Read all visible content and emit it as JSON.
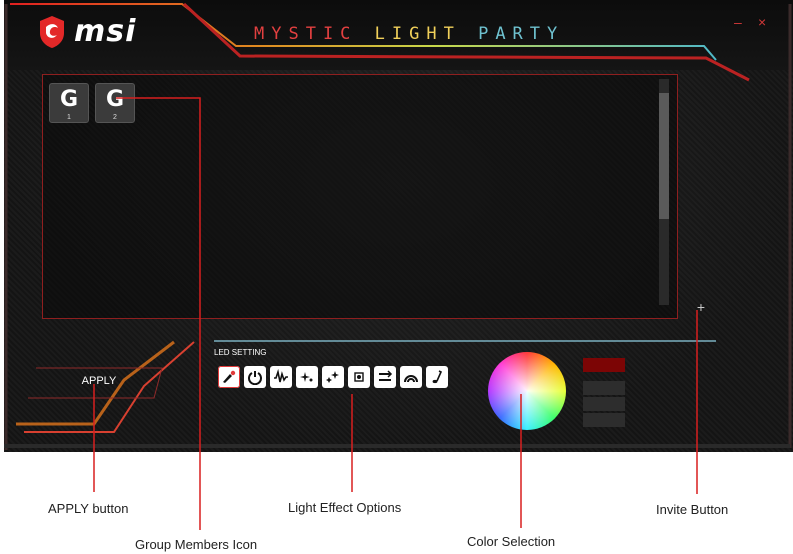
{
  "app": {
    "brand": "msi",
    "title_part1": "MYSTIC ",
    "title_part2": "LIGHT ",
    "title_part3": "PARTY",
    "minimize_label": "–",
    "close_label": "×"
  },
  "members": [
    {
      "glyph": "G",
      "number": "1"
    },
    {
      "glyph": "G",
      "number": "2"
    }
  ],
  "invite_label": "+",
  "apply_label": "APPLY",
  "led_setting_label": "LED SETTING",
  "effects": [
    {
      "name": "color-palette-icon"
    },
    {
      "name": "power-icon"
    },
    {
      "name": "wave-icon"
    },
    {
      "name": "sparkle-icon"
    },
    {
      "name": "stars-icon"
    },
    {
      "name": "burst-icon"
    },
    {
      "name": "arrows-icon"
    },
    {
      "name": "rainbow-icon"
    },
    {
      "name": "music-icon"
    }
  ],
  "color_swatches": [
    "#7c0505",
    "#2d2d2d",
    "#2d2d2d",
    "#2d2d2d"
  ],
  "annotations": {
    "apply": "APPLY button",
    "members": "Group Members Icon",
    "effects": "Light Effect Options",
    "color": "Color Selection",
    "invite": "Invite Button"
  }
}
